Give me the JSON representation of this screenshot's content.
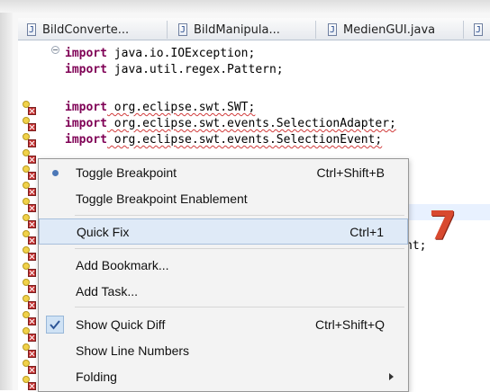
{
  "tabs": [
    {
      "label": "BildConverte...",
      "icon": "java-file-icon"
    },
    {
      "label": "BildManipula...",
      "icon": "java-file-icon"
    },
    {
      "label": "MedienGUI.java",
      "icon": "java-file-icon"
    },
    {
      "label": "",
      "icon": "java-file-icon"
    }
  ],
  "code": {
    "lines": [
      {
        "prefix": "import",
        "rest": " java.io.IOException;"
      },
      {
        "prefix": "import",
        "rest": " java.util.regex.Pattern;"
      },
      {
        "prefix": "import",
        "rest": " org.eclipse.swt.SWT;"
      },
      {
        "prefix": "import",
        "rest": " org.eclipse.swt.events.SelectionAdapter;"
      },
      {
        "prefix": "import",
        "rest": " org.eclipse.swt.events.SelectionEvent;"
      },
      {
        "prefix": "",
        "rest": "nt;"
      }
    ]
  },
  "context_menu": {
    "items": [
      {
        "label": "Toggle Breakpoint",
        "shortcut": "Ctrl+Shift+B",
        "icon": "breakpoint-dot-icon",
        "active": false,
        "checked": false
      },
      {
        "label": "Toggle Breakpoint Enablement",
        "shortcut": "",
        "icon": "",
        "active": false,
        "checked": false
      },
      {
        "label": "Quick Fix",
        "shortcut": "Ctrl+1",
        "icon": "",
        "active": true,
        "checked": false
      },
      {
        "label": "Add Bookmark...",
        "shortcut": "",
        "icon": "",
        "active": false,
        "checked": false
      },
      {
        "label": "Add Task...",
        "shortcut": "",
        "icon": "",
        "active": false,
        "checked": false
      },
      {
        "label": "Show Quick Diff",
        "shortcut": "Ctrl+Shift+Q",
        "icon": "checkmark-icon",
        "active": false,
        "checked": true
      },
      {
        "label": "Show Line Numbers",
        "shortcut": "",
        "icon": "",
        "active": false,
        "checked": false
      },
      {
        "label": "Folding",
        "shortcut": "",
        "icon": "submenu-arrow-icon",
        "active": false,
        "checked": false
      }
    ]
  },
  "annotation": {
    "label": "7",
    "color": "#d8492f"
  },
  "colors": {
    "keyword": "#7f0055",
    "error_badge": "#c73434",
    "menu_active": "#dfeaf7"
  }
}
